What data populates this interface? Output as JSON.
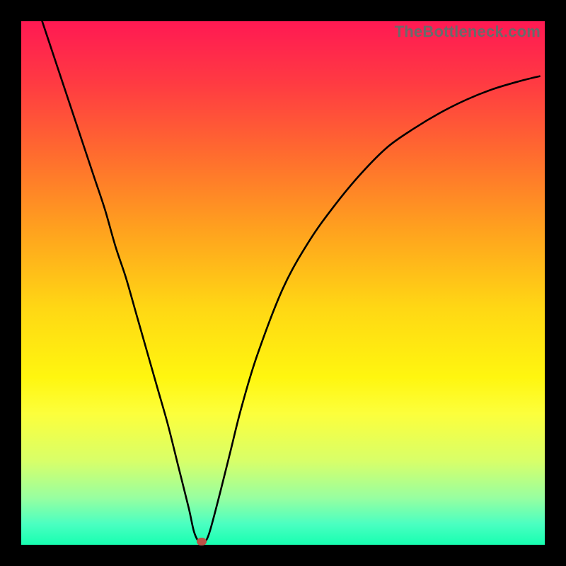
{
  "watermark": "TheBottleneck.com",
  "chart_data": {
    "type": "line",
    "title": "",
    "xlabel": "",
    "ylabel": "",
    "xlim": [
      0,
      100
    ],
    "ylim": [
      0,
      100
    ],
    "grid": false,
    "legend": false,
    "series": [
      {
        "name": "bottleneck-curve",
        "x": [
          4,
          6,
          8,
          10,
          12,
          14,
          16,
          18,
          20,
          22,
          24,
          26,
          28,
          30,
          32,
          33,
          34,
          35,
          36,
          38,
          40,
          42,
          45,
          50,
          55,
          60,
          65,
          70,
          75,
          80,
          85,
          90,
          95,
          99
        ],
        "values": [
          100,
          94,
          88,
          82,
          76,
          70,
          64,
          57,
          51,
          44,
          37,
          30,
          23,
          15,
          7,
          2.5,
          0.5,
          0.5,
          2.5,
          10,
          18,
          26,
          36,
          49,
          58,
          65,
          71,
          76,
          79.5,
          82.5,
          85,
          87,
          88.5,
          89.5
        ]
      }
    ],
    "annotations": [
      {
        "name": "minimum-marker",
        "x": 34.5,
        "y": 0.6,
        "color": "#bb5347",
        "size": 1.6
      }
    ],
    "background_gradient": [
      "#ff1953",
      "#ff6a2f",
      "#ffd814",
      "#fcff3c",
      "#4bffc1",
      "#17ffb1"
    ]
  },
  "plot": {
    "stroke": "#000000",
    "stroke_width": 2.6
  }
}
